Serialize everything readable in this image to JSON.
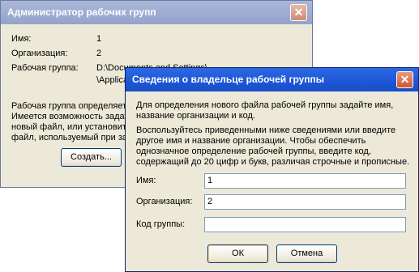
{
  "back_window": {
    "title": "Администратор рабочих групп",
    "name_label": "Имя:",
    "name_value": "1",
    "org_label": "Организация:",
    "org_value": "2",
    "workgroup_label": "Рабочая группа:",
    "workgroup_value_line1": "D:\\Documents and Settings\\",
    "workgroup_value_line2": "\\Applica",
    "info_lines": [
      "Рабочая группа определяет",
      "Имеется возможность задат",
      "новый файл, или установит",
      "файл, используемый при зап"
    ],
    "create_button": "Создать..."
  },
  "dialog": {
    "title": "Сведения о владельце рабочей группы",
    "intro_line1": "Для определения нового файла рабочей группы задайте имя,",
    "intro_line2": "название организации и код.",
    "help_line1": "Воспользуйтесь приведенными ниже сведениями или введите",
    "help_line2": "другое имя и название организации.  Чтобы обеспечить",
    "help_line3": "однозначное определение рабочей группы, введите код,",
    "help_line4": "содержащий до 20 цифр и букв, различая строчные и прописные.",
    "name_label": "Имя:",
    "name_value": "1",
    "org_label": "Организация:",
    "org_value": "2",
    "code_label": "Код группы:",
    "code_value": "",
    "ok_button": "ОК",
    "cancel_button": "Отмена"
  }
}
